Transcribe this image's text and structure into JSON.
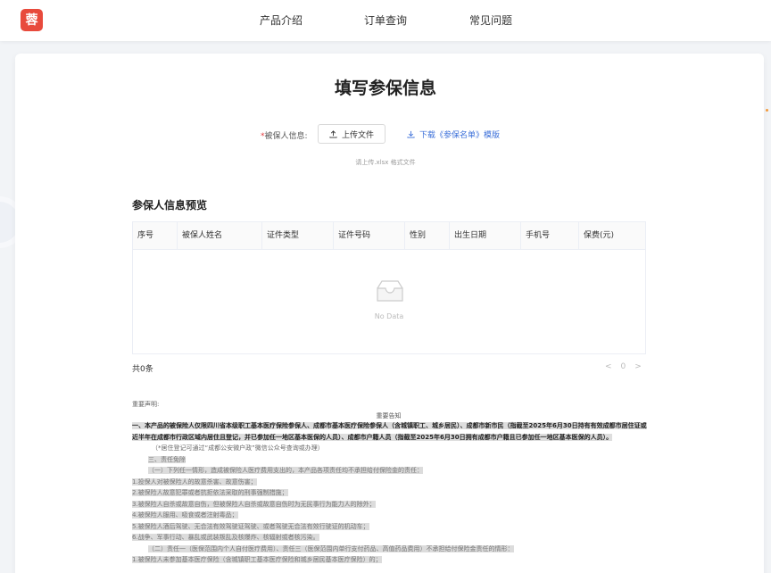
{
  "header": {
    "logo_glyph": "蓉",
    "nav": [
      "产品介绍",
      "订单查询",
      "常见问题"
    ]
  },
  "form": {
    "title": "填写参保信息",
    "required_mark": "*",
    "label": "被保人信息:",
    "upload_label": "上传文件",
    "download_label": "下载《参保名单》模版",
    "hint": "请上传.xlsx 格式文件"
  },
  "preview": {
    "title": "参保人信息预览",
    "columns": [
      "序号",
      "被保人姓名",
      "证件类型",
      "证件号码",
      "性别",
      "出生日期",
      "手机号",
      "保费(元)"
    ],
    "empty_text": "No Data",
    "total": "共0条",
    "page_prev": "<",
    "page_num": "0",
    "page_next": ">"
  },
  "declaration": {
    "label": "重要声明:",
    "notice_title": "重要告知",
    "bold_para": "一、本产品的被保险人仅限四川省本级职工基本医疗保险参保人、成都市基本医疗保险参保人（含城镇职工、城乡居民）、成都市新市民（指截至2025年6月30日持有有效成都市居住证或近半年在成都市行政区域内居住且登记，并已参加任一地区基本医保的人员）、成都市户籍人员（指截至2025年6月30日拥有成都市户籍且已参加任一地区基本医保的人员）。",
    "line_note": "（*居住登记可通过“成都公安微户政”微信公众号查询或办理）",
    "line_section": "三、责任免除",
    "line_sub1": "（一）下列任一情形，造成被保险人医疗费用支出的，本产品各项责任均不承担给付保险金的责任：",
    "items": [
      "1.投保人对被保险人的故意杀害、故意伤害；",
      "2.被保险人故意犯罪或者抗拒依法采取的刑事强制措施；",
      "3.被保险人自杀或故意自伤，但被保险人自杀或故意自伤时为无民事行为能力人的除外；",
      "4.被保险人服用、吸食或者注射毒品；",
      "5.被保险人酒后驾驶、无合法有效驾驶证驾驶、或者驾驶无合法有效行驶证的机动车；",
      "6.战争、军事行动、暴乱或武装叛乱及核爆炸、核辐射或者核污染。"
    ],
    "line_sub2": "（二）责任一（医保范围内个人自付医疗费用）、责任三（医保范围内单行支付药品、高值药品费用）不承担给付保险金责任的情形：",
    "line_last": "1.被保险人未参加基本医疗保险（含城镇职工基本医疗保险和城乡居民基本医疗保险）的；"
  }
}
